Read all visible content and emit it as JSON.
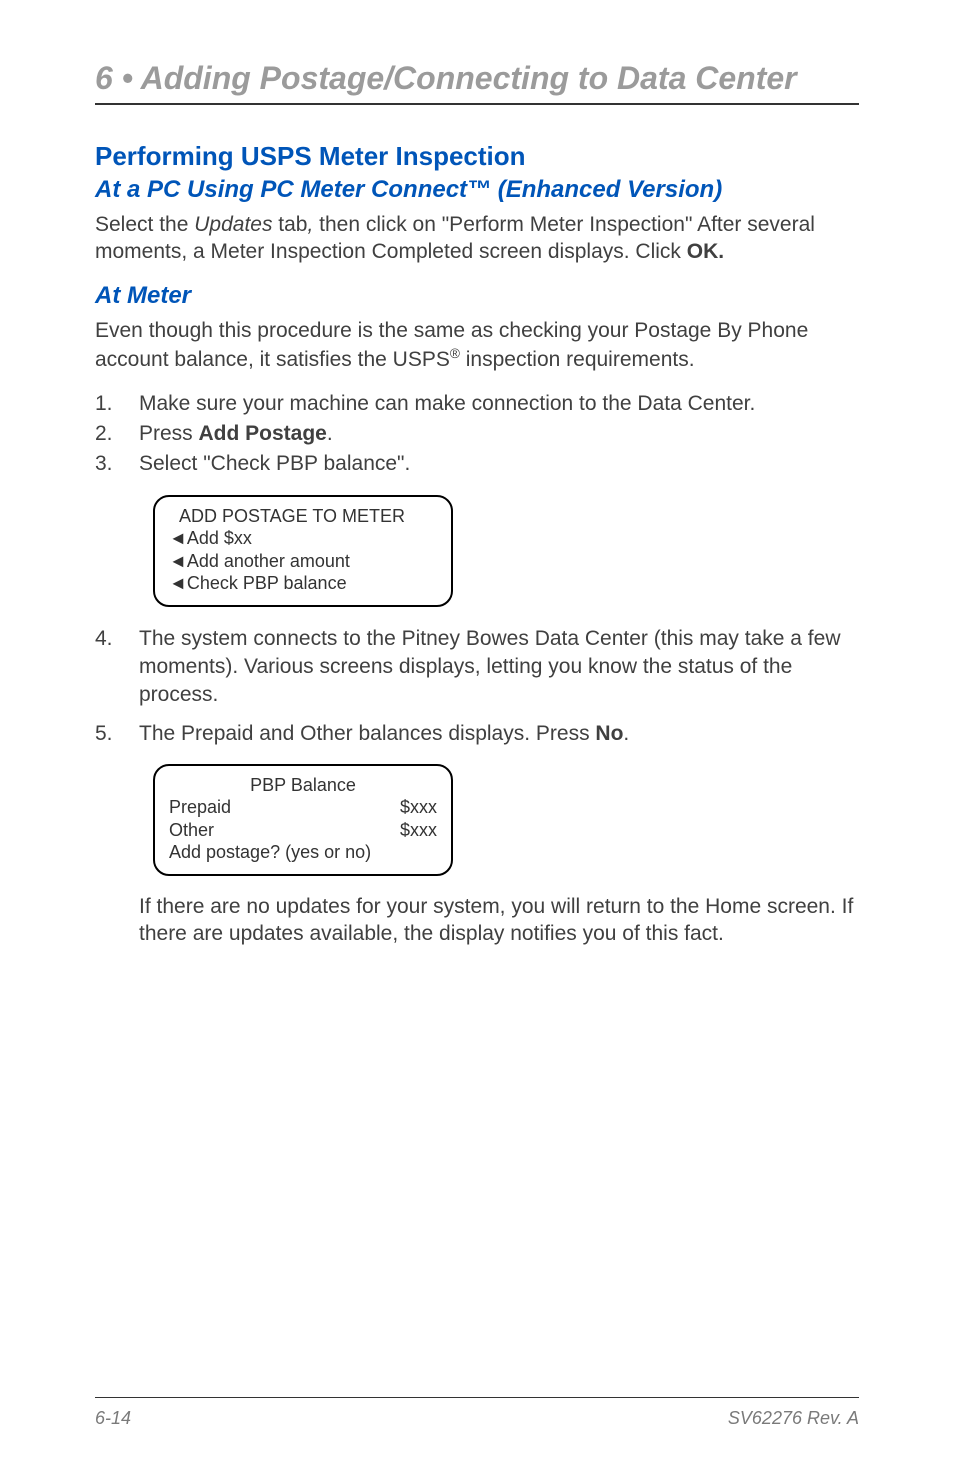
{
  "header": {
    "chapter": "6 • Adding Postage/Connecting to Data Center"
  },
  "section": {
    "title": "Performing USPS Meter Inspection",
    "sub1_title": "At a PC Using PC Meter Connect™ (Enhanced Version)",
    "sub1_para_parts": {
      "a": "Select the ",
      "b": "Updates",
      "c": " tab",
      "d": ",",
      "e": " then click on \"Perform Meter Inspection\" After several moments, a Meter Inspection Completed screen displays. Click ",
      "f": "OK."
    },
    "sub2_title": "At Meter",
    "sub2_para_parts": {
      "a": "Even though this procedure is the same as checking your Postage By Phone account balance, it satisfies the USPS",
      "b": "®",
      "c": " inspection requirements."
    },
    "steps": [
      {
        "num": "1.",
        "parts": {
          "a": "Make sure your machine can make connection to the Data Center."
        }
      },
      {
        "num": "2.",
        "parts": {
          "a": "Press ",
          "b": "Add Postage",
          "c": "."
        }
      },
      {
        "num": "3.",
        "parts": {
          "a": "Select \"Check PBP balance\"."
        }
      }
    ],
    "screen1": {
      "title": "ADD POSTAGE TO METER",
      "line1": "◄Add $xx",
      "line2": "◄Add another amount",
      "line3": "◄Check PBP balance"
    },
    "steps_cont": [
      {
        "num": "4.",
        "parts": {
          "a": "The system connects to the Pitney Bowes Data Center (this may take a few moments). Various screens displays, letting you know the status of the process."
        }
      },
      {
        "num": "5.",
        "parts": {
          "a": "The Prepaid and Other balances displays. Press ",
          "b": "No",
          "c": "."
        }
      }
    ],
    "screen2": {
      "title": "PBP Balance",
      "row1": {
        "label": "Prepaid",
        "value": "$xxx"
      },
      "row2": {
        "label": "Other",
        "value": "$xxx"
      },
      "footer": "Add  postage?  (yes  or  no)"
    },
    "final_para": "If there are no updates for your system, you will return to the Home screen. If there are updates available, the display notifies you of this fact."
  },
  "footer": {
    "left": "6-14",
    "right": "SV62276 Rev. A"
  }
}
